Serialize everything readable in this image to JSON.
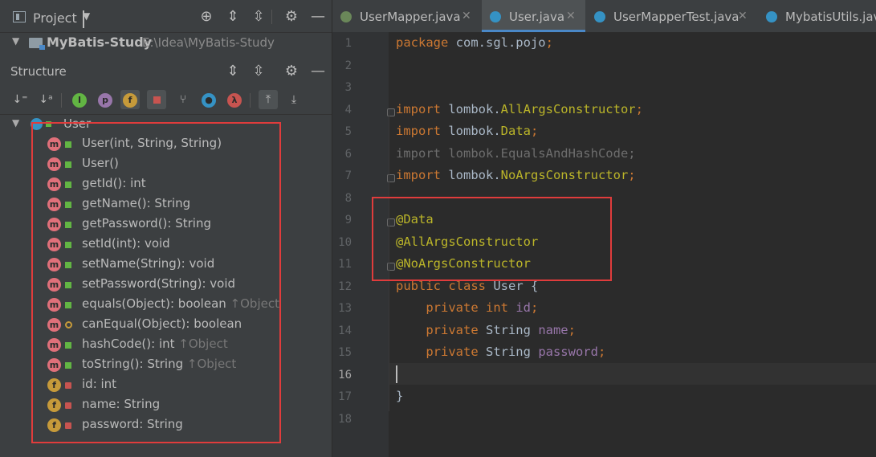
{
  "project_panel": {
    "title": "Project",
    "project_name": "MyBatis-Study",
    "project_path": "E:\\Idea\\MyBatis-Study"
  },
  "structure_panel": {
    "title": "Structure",
    "root": "User",
    "members": [
      {
        "kind": "m",
        "vis": "pub",
        "label": "User(int, String, String)",
        "inherited": ""
      },
      {
        "kind": "m",
        "vis": "pub",
        "label": "User()",
        "inherited": ""
      },
      {
        "kind": "m",
        "vis": "pub",
        "label": "getId(): int",
        "inherited": ""
      },
      {
        "kind": "m",
        "vis": "pub",
        "label": "getName(): String",
        "inherited": ""
      },
      {
        "kind": "m",
        "vis": "pub",
        "label": "getPassword(): String",
        "inherited": ""
      },
      {
        "kind": "m",
        "vis": "pub",
        "label": "setId(int): void",
        "inherited": ""
      },
      {
        "kind": "m",
        "vis": "pub",
        "label": "setName(String): void",
        "inherited": ""
      },
      {
        "kind": "m",
        "vis": "pub",
        "label": "setPassword(String): void",
        "inherited": ""
      },
      {
        "kind": "m",
        "vis": "pub",
        "label": "equals(Object): boolean",
        "inherited": "↑Object"
      },
      {
        "kind": "m",
        "vis": "prot",
        "label": "canEqual(Object): boolean",
        "inherited": ""
      },
      {
        "kind": "m",
        "vis": "pub",
        "label": "hashCode(): int",
        "inherited": "↑Object"
      },
      {
        "kind": "m",
        "vis": "pub",
        "label": "toString(): String",
        "inherited": "↑Object"
      },
      {
        "kind": "f",
        "vis": "priv",
        "label": "id: int",
        "inherited": ""
      },
      {
        "kind": "f",
        "vis": "priv",
        "label": "name: String",
        "inherited": ""
      },
      {
        "kind": "f",
        "vis": "priv",
        "label": "password: String",
        "inherited": ""
      }
    ]
  },
  "tabs": [
    {
      "label": "UserMapper.java",
      "icon_color": "#6a8759",
      "active": false
    },
    {
      "label": "User.java",
      "icon_color": "#3592c4",
      "active": true
    },
    {
      "label": "UserMapperTest.java",
      "icon_color": "#3592c4",
      "active": false
    },
    {
      "label": "MybatisUtils.java",
      "icon_color": "#3592c4",
      "active": false
    }
  ],
  "editor": {
    "current_line": 16,
    "lines": [
      {
        "n": "1",
        "code": [
          [
            "kw",
            "package "
          ],
          [
            "pk",
            "com.sgl.pojo"
          ],
          [
            "kw",
            ";"
          ]
        ]
      },
      {
        "n": "2",
        "code": []
      },
      {
        "n": "3",
        "code": []
      },
      {
        "n": "4",
        "code": [
          [
            "kw",
            "import "
          ],
          [
            "pk",
            "lombok."
          ],
          [
            "an",
            "AllArgsConstructor"
          ],
          [
            "kw",
            ";"
          ]
        ]
      },
      {
        "n": "5",
        "code": [
          [
            "kw",
            "import "
          ],
          [
            "pk",
            "lombok."
          ],
          [
            "an",
            "Data"
          ],
          [
            "kw",
            ";"
          ]
        ]
      },
      {
        "n": "6",
        "code": [
          [
            "dim",
            "import lombok.EqualsAndHashCode;"
          ]
        ]
      },
      {
        "n": "7",
        "code": [
          [
            "kw",
            "import "
          ],
          [
            "pk",
            "lombok."
          ],
          [
            "an",
            "NoArgsConstructor"
          ],
          [
            "kw",
            ";"
          ]
        ]
      },
      {
        "n": "8",
        "code": []
      },
      {
        "n": "9",
        "code": [
          [
            "an",
            "@Data"
          ]
        ]
      },
      {
        "n": "10",
        "code": [
          [
            "an",
            "@AllArgsConstructor"
          ]
        ]
      },
      {
        "n": "11",
        "code": [
          [
            "an",
            "@NoArgsConstructor"
          ]
        ]
      },
      {
        "n": "12",
        "code": [
          [
            "kw",
            "public class "
          ],
          [
            "pk",
            "User {"
          ]
        ]
      },
      {
        "n": "13",
        "code": [
          [
            "pk",
            "    "
          ],
          [
            "kw",
            "private int "
          ],
          [
            "fld",
            "id"
          ],
          [
            "kw",
            ";"
          ]
        ]
      },
      {
        "n": "14",
        "code": [
          [
            "pk",
            "    "
          ],
          [
            "kw",
            "private "
          ],
          [
            "pk",
            "String "
          ],
          [
            "fld",
            "name"
          ],
          [
            "kw",
            ";"
          ]
        ]
      },
      {
        "n": "15",
        "code": [
          [
            "pk",
            "    "
          ],
          [
            "kw",
            "private "
          ],
          [
            "pk",
            "String "
          ],
          [
            "fld",
            "password"
          ],
          [
            "kw",
            ";"
          ]
        ]
      },
      {
        "n": "16",
        "code": []
      },
      {
        "n": "17",
        "code": [
          [
            "pk",
            "}"
          ]
        ]
      },
      {
        "n": "18",
        "code": []
      }
    ]
  }
}
